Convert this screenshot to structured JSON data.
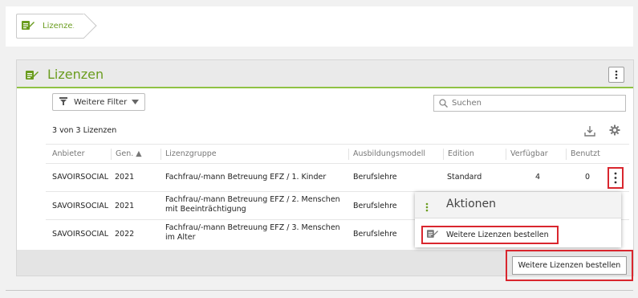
{
  "breadcrumb": {
    "label": "Lizenzen"
  },
  "panel": {
    "title": "Lizenzen",
    "menu_icon": "kebab-icon"
  },
  "filter": {
    "label": "Weitere Filter"
  },
  "search": {
    "placeholder": "Suchen"
  },
  "count": "3 von 3 Lizenzen",
  "table": {
    "headers": [
      "Anbieter",
      "Gen. ▲",
      "Lizenzgruppe",
      "Ausbildungsmodell",
      "Edition",
      "Verfügbar",
      "Benutzt"
    ],
    "rows": [
      {
        "anbieter": "SAVOIRSOCIAL",
        "gen": "2021",
        "lizenzgruppe": "Fachfrau/-mann Betreuung EFZ / 1. Kinder",
        "ausbildungsmodell": "Berufslehre",
        "edition": "Standard",
        "verfuegbar": "4",
        "benutzt": "0"
      },
      {
        "anbieter": "SAVOIRSOCIAL",
        "gen": "2021",
        "lizenzgruppe": "Fachfrau/-mann Betreuung EFZ / 2. Menschen mit Beeinträchtigung",
        "ausbildungsmodell": "Berufslehre",
        "edition": "",
        "verfuegbar": "",
        "benutzt": ""
      },
      {
        "anbieter": "SAVOIRSOCIAL",
        "gen": "2022",
        "lizenzgruppe": "Fachfrau/-mann Betreuung EFZ / 3. Menschen im Alter",
        "ausbildungsmodell": "Berufslehre",
        "edition": "",
        "verfuegbar": "",
        "benutzt": ""
      }
    ]
  },
  "actions_menu": {
    "title": "Aktionen",
    "item": "Weitere Lizenzen bestellen"
  },
  "footer_button": "Weitere Lizenzen bestellen",
  "colors": {
    "accent": "#6a9c1e",
    "highlight": "#d9262e"
  }
}
